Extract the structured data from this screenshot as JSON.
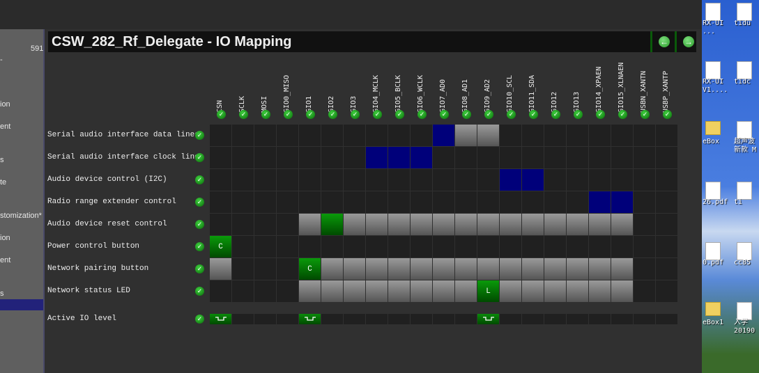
{
  "window": {
    "title": "CSW_282_Rf_Delegate - IO Mapping"
  },
  "nav": {
    "back_icon": "arrow-left-icon",
    "forward_icon": "arrow-right-icon"
  },
  "sidebar": {
    "items": [
      "591",
      "-",
      "ion",
      "ent",
      "s",
      "te",
      "stomization*",
      "ion",
      "ent",
      "s",
      ""
    ],
    "selected_index": 10
  },
  "columns": [
    "CSN",
    "SCLK",
    "MOSI",
    "GIO0_MISO",
    "GIO1",
    "GIO2",
    "GIO3",
    "GIO4_MCLK",
    "GIO5_BCLK",
    "GIO6_WCLK",
    "GIO7_AD0",
    "GIO8_AD1",
    "GIO9_AD2",
    "GIO10_SCL",
    "GIO11_SDA",
    "GIO12",
    "GIO13",
    "GIO14_XPAEN",
    "GIO15_XLNAEN",
    "USBN_XANTN",
    "USBP_XANTP"
  ],
  "rows": [
    {
      "label": "Serial audio interface data lines",
      "cells": {
        "10": "blue",
        "11": "gray",
        "12": "gray"
      }
    },
    {
      "label": "Serial audio interface clock lines",
      "cells": {
        "7": "blue",
        "8": "blue",
        "9": "blue"
      }
    },
    {
      "label": "Audio device control (I2C)",
      "cells": {
        "13": "blue",
        "14": "blue"
      }
    },
    {
      "label": "Radio range extender control",
      "cells": {
        "17": "blue",
        "18": "blue"
      }
    },
    {
      "label": "Audio device reset control",
      "cells": {
        "4": "gray",
        "5": "green",
        "6": "gray",
        "7": "gray",
        "8": "gray",
        "9": "gray",
        "10": "gray",
        "11": "gray",
        "12": "gray",
        "13": "gray",
        "14": "gray",
        "15": "gray",
        "16": "gray",
        "17": "gray",
        "18": "gray"
      }
    },
    {
      "label": "Power control button",
      "cells": {
        "0": "green"
      },
      "marks": {
        "0": "C"
      }
    },
    {
      "label": "Network pairing button",
      "cells": {
        "0": "gray",
        "4": "green",
        "5": "gray",
        "6": "gray",
        "7": "gray",
        "8": "gray",
        "9": "gray",
        "10": "gray",
        "11": "gray",
        "12": "gray",
        "13": "gray",
        "14": "gray",
        "15": "gray",
        "16": "gray",
        "17": "gray",
        "18": "gray"
      },
      "marks": {
        "4": "C"
      }
    },
    {
      "label": "Network status LED",
      "cells": {
        "4": "gray",
        "5": "gray",
        "6": "gray",
        "7": "gray",
        "8": "gray",
        "9": "gray",
        "10": "gray",
        "11": "gray",
        "12": "green",
        "13": "gray",
        "14": "gray",
        "15": "gray",
        "16": "gray",
        "17": "gray",
        "18": "gray"
      },
      "marks": {
        "12": "L"
      }
    }
  ],
  "active_io": {
    "label": "Active IO level",
    "active_columns": [
      0,
      4,
      12
    ],
    "icon": "active-low-pulse-icon"
  },
  "colors": {
    "assigned": "#00007a",
    "selected": "#0a8a0a",
    "available": "#808080",
    "empty": "#202020"
  },
  "desktop": {
    "labels": [
      "RX-UI ...",
      "tidu",
      "RX-UI V1....",
      "tidc",
      "eBox",
      "超声波 新款 M",
      "26.pdf",
      "ti",
      "0.pdf",
      "cc85",
      "eBox1",
      "入学 20190"
    ]
  }
}
